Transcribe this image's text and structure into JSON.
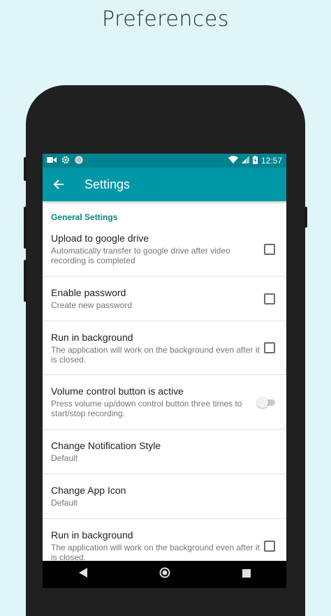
{
  "headline": "Preferences",
  "status_bar": {
    "time": "12:57",
    "icons": [
      "video-icon",
      "gear-icon",
      "circle-icon",
      "wifi-icon",
      "signal-icon",
      "battery-charging-icon"
    ]
  },
  "toolbar": {
    "title": "Settings"
  },
  "settings": {
    "category": "General Settings",
    "items": [
      {
        "title": "Upload to google drive",
        "summary": "Automatically transfer to google drive after video recording is completed",
        "control": "checkbox",
        "checked": false
      },
      {
        "title": "Enable password",
        "summary": "Create new password",
        "control": "checkbox",
        "checked": false
      },
      {
        "title": "Run in background",
        "summary": "The application will work on the background even after it is closed.",
        "control": "checkbox",
        "checked": false
      },
      {
        "title": "Volume control button is active",
        "summary": "Press volume up/down control button three times to start/stop recording.",
        "control": "switch",
        "checked": false
      },
      {
        "title": "Change Notification Style",
        "summary": "Default",
        "control": "none"
      },
      {
        "title": "Change App Icon",
        "summary": "Default",
        "control": "none"
      },
      {
        "title": "Run in background",
        "summary": "The application will work on the background even after it is closed.",
        "control": "checkbox",
        "checked": false
      }
    ]
  },
  "nav_bar": {
    "buttons": [
      "back-icon",
      "home-icon",
      "recents-icon"
    ]
  },
  "colors": {
    "background": "#dff5f8",
    "primary": "#0097a7",
    "primary_dark": "#00838f",
    "accent": "#00897b",
    "phone_body": "#202020"
  }
}
